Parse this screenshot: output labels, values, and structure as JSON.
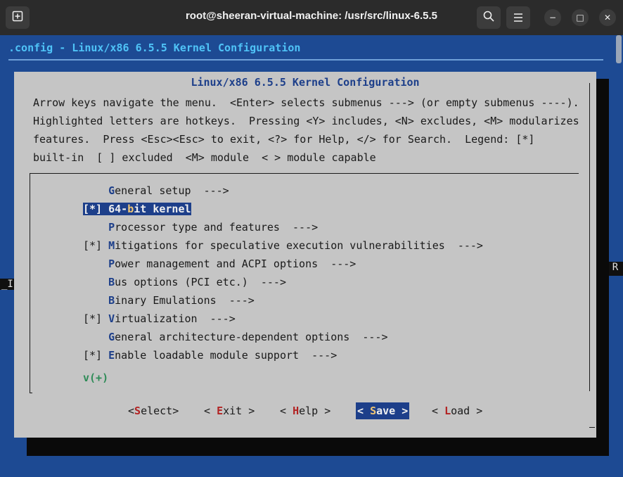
{
  "window": {
    "title": "root@sheeran-virtual-machine: /usr/src/linux-6.5.5",
    "new_tab_icon": "new-tab-icon",
    "search_icon": "search-icon",
    "menu_icon": "hamburger-menu-icon",
    "minimize": "−",
    "maximize": "□",
    "close": "✕"
  },
  "terminal": {
    "config_line": ".config - Linux/x86 6.5.5 Kernel Configuration",
    "side_left": "_I",
    "side_right": "R"
  },
  "dialog": {
    "title": "Linux/x86 6.5.5 Kernel Configuration",
    "help_lines": [
      "Arrow keys navigate the menu.  <Enter> selects submenus ---> (or empty submenus ----).",
      "Highlighted letters are hotkeys.  Pressing <Y> includes, <N> excludes, <M> modularizes",
      "features.  Press <Esc><Esc> to exit, <?> for Help, </> for Search.  Legend: [*]",
      "built-in  [ ] excluded  <M> module  < > module capable"
    ]
  },
  "menu": {
    "items": [
      {
        "prefix": "    ",
        "hot": "G",
        "rest": "eneral setup  --->",
        "selected": false
      },
      {
        "prefix": "[*] ",
        "pre": "64-",
        "hot": "b",
        "rest": "it kernel",
        "selected": true
      },
      {
        "prefix": "    ",
        "hot": "P",
        "rest": "rocessor type and features  --->",
        "selected": false
      },
      {
        "prefix": "[*] ",
        "hot": "M",
        "rest": "itigations for speculative execution vulnerabilities  --->",
        "selected": false
      },
      {
        "prefix": "    ",
        "hot": "P",
        "rest": "ower management and ACPI options  --->",
        "selected": false
      },
      {
        "prefix": "    ",
        "hot": "B",
        "rest": "us options (PCI etc.)  --->",
        "selected": false
      },
      {
        "prefix": "    ",
        "hot": "B",
        "rest": "inary Emulations  --->",
        "selected": false
      },
      {
        "prefix": "[*] ",
        "hot": "V",
        "rest": "irtualization  --->",
        "selected": false
      },
      {
        "prefix": "    ",
        "hot": "G",
        "rest": "eneral architecture-dependent options  --->",
        "selected": false
      },
      {
        "prefix": "[*] ",
        "hot": "E",
        "rest": "nable loadable module support  --->",
        "selected": false
      }
    ],
    "more_indicator": "v(+)"
  },
  "buttons": {
    "select": {
      "pre": "<",
      "hot": "S",
      "post": "elect>"
    },
    "exit": {
      "pre": "< ",
      "hot": "E",
      "post": "xit >"
    },
    "help": {
      "pre": "< ",
      "hot": "H",
      "post": "elp >"
    },
    "save": {
      "pre": "< ",
      "hot": "S",
      "post": "ave >"
    },
    "load": {
      "pre": "< ",
      "hot": "L",
      "post": "oad >"
    }
  }
}
